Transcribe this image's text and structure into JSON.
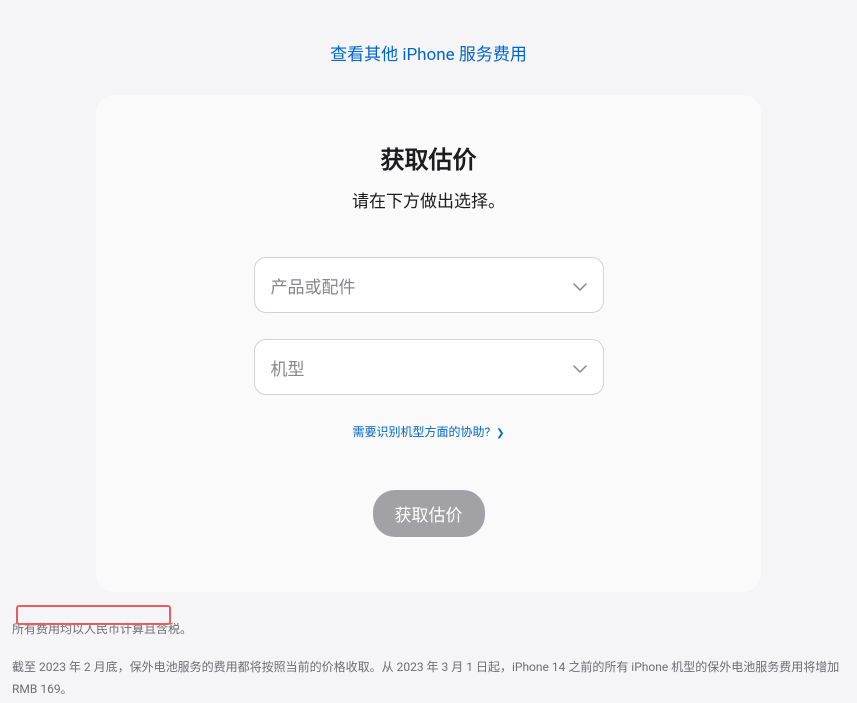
{
  "top_link": "查看其他 iPhone 服务费用",
  "card": {
    "title": "获取估价",
    "subtitle": "请在下方做出选择。",
    "select1_placeholder": "产品或配件",
    "select2_placeholder": "机型",
    "help_text": "需要识别机型方面的协助?",
    "submit_label": "获取估价"
  },
  "footer": {
    "line1": "所有费用均以人民币计算且含税。",
    "line2": "截至 2023 年 2 月底，保外电池服务的费用都将按照当前的价格收取。从 2023 年 3 月 1 日起，iPhone 14 之前的所有 iPhone 机型的保外电池服务费用将增加 RMB 169。"
  }
}
